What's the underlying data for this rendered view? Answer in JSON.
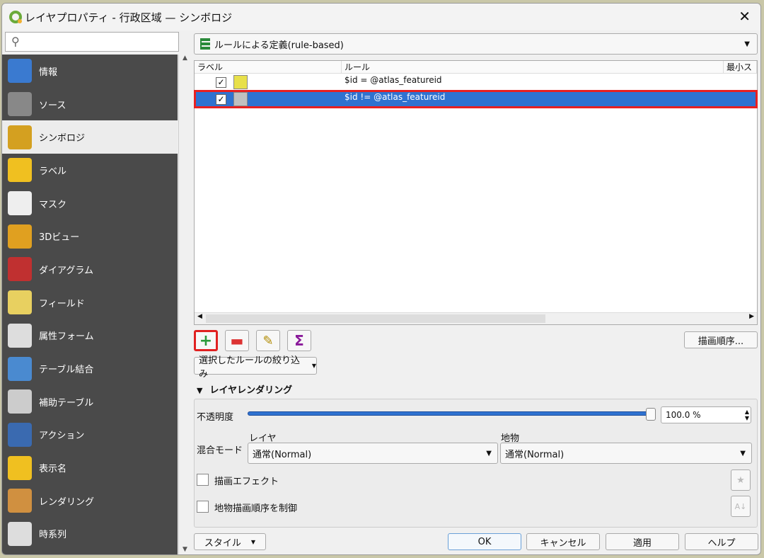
{
  "title": "レイヤプロパティ - 行政区域 — シンボロジ",
  "search": {
    "placeholder": ""
  },
  "sidebar": {
    "items": [
      {
        "label": "情報",
        "icon": "info-icon"
      },
      {
        "label": "ソース",
        "icon": "source-icon"
      },
      {
        "label": "シンボロジ",
        "icon": "symbology-icon"
      },
      {
        "label": "ラベル",
        "icon": "label-icon"
      },
      {
        "label": "マスク",
        "icon": "mask-icon"
      },
      {
        "label": "3Dビュー",
        "icon": "3d-view-icon"
      },
      {
        "label": "ダイアグラム",
        "icon": "diagram-icon"
      },
      {
        "label": "フィールド",
        "icon": "fields-icon"
      },
      {
        "label": "属性フォーム",
        "icon": "attribute-form-icon"
      },
      {
        "label": "テーブル結合",
        "icon": "join-icon"
      },
      {
        "label": "補助テーブル",
        "icon": "auxiliary-storage-icon"
      },
      {
        "label": "アクション",
        "icon": "actions-icon"
      },
      {
        "label": "表示名",
        "icon": "display-icon"
      },
      {
        "label": "レンダリング",
        "icon": "rendering-icon"
      },
      {
        "label": "時系列",
        "icon": "temporal-icon"
      }
    ]
  },
  "renderer": "ルールによる定義(rule-based)",
  "table": {
    "headers": [
      "ラベル",
      "ルール",
      "最小ス"
    ],
    "rows": [
      {
        "rule": "$id =  @atlas_featureid",
        "color": "#e8e04a",
        "checked": true
      },
      {
        "rule": "$id !=  @atlas_featureid",
        "color": "#c0c0c0",
        "checked": true
      }
    ]
  },
  "buttons": {
    "order": "描画順序...",
    "filter": "選択したルールの絞り込み",
    "style": "スタイル",
    "ok": "OK",
    "cancel": "キャンセル",
    "apply": "適用",
    "help": "ヘルプ"
  },
  "rendering": {
    "title": "レイヤレンダリング",
    "opacity_label": "不透明度",
    "opacity_value": "100.0 %",
    "opacity": 100,
    "blend_label": "混合モード",
    "layer_label": "レイヤ",
    "feature_label": "地物",
    "layer_blend": "通常(Normal)",
    "feature_blend": "通常(Normal)",
    "effects": "描画エフェクト",
    "order_by": "地物描画順序を制御"
  }
}
